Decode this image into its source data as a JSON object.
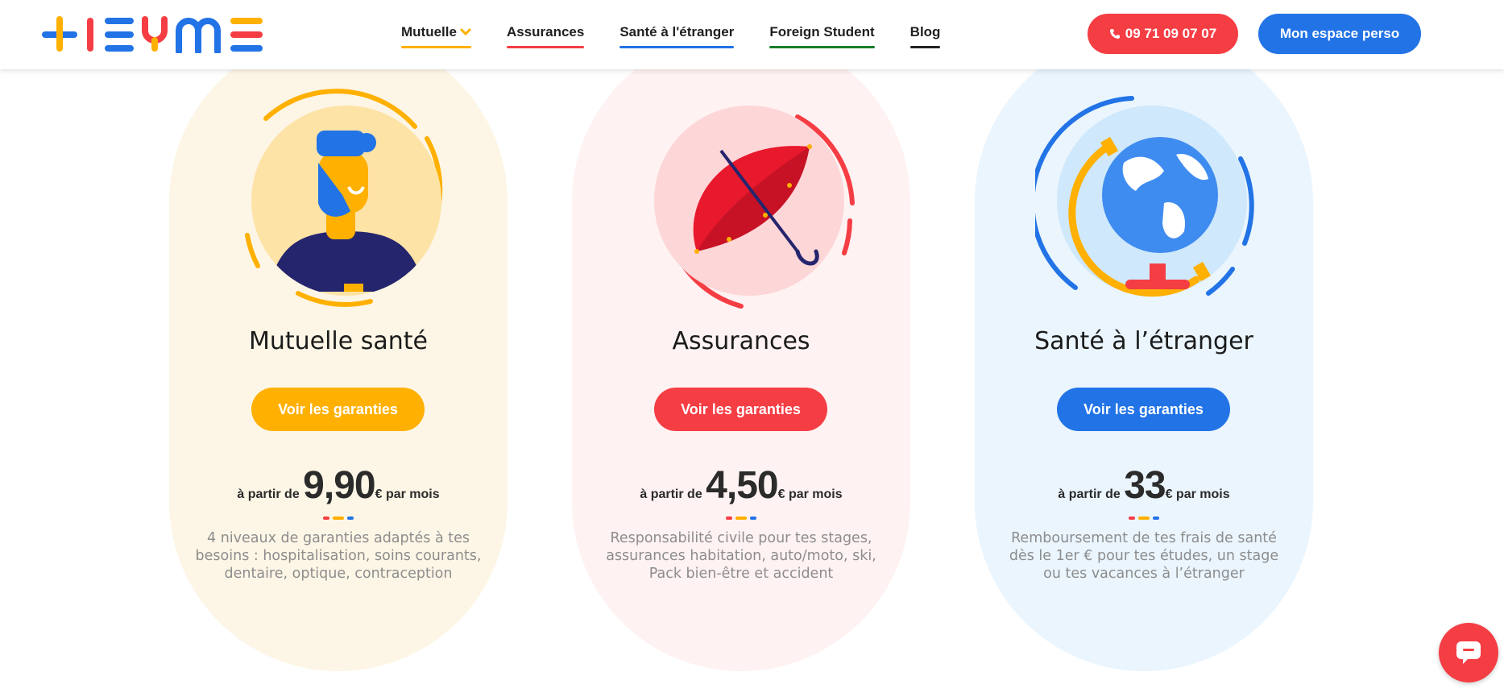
{
  "brand": {
    "logo_text": "HEYME",
    "colors": {
      "yellow": "#ffb000",
      "red": "#f53d44",
      "blue": "#2273e6",
      "green": "#1a7d2b",
      "dark": "#222222"
    }
  },
  "nav": {
    "items": [
      {
        "label": "Mutuelle",
        "underline": "#ffb000",
        "has_dropdown": true
      },
      {
        "label": "Assurances",
        "underline": "#f53d44"
      },
      {
        "label": "Santé à l'étranger",
        "underline": "#2273e6"
      },
      {
        "label": "Foreign Student",
        "underline": "#1a7d2b"
      },
      {
        "label": "Blog",
        "underline": "#222222"
      }
    ],
    "phone_label": "09 71 09 07 07",
    "account_label": "Mon espace perso"
  },
  "cards": [
    {
      "title": "Mutuelle santé",
      "cta": "Voir les garanties",
      "price_prefix": "à partir de",
      "price": "9,90",
      "price_suffix": "€ par mois",
      "description": "4 niveaux de garanties adaptés à tes besoins : hospitalisation, soins courants, dentaire, optique, contraception",
      "bg": "#fdf6e6",
      "accent": "#ffb000",
      "icon": "bearded-man-icon"
    },
    {
      "title": "Assurances",
      "cta": "Voir les garanties",
      "price_prefix": "à partir de",
      "price": "4,50",
      "price_suffix": "€ par mois",
      "description": "Responsabilité civile pour tes stages, assurances habitation, auto/moto, ski, Pack bien-être et accident",
      "bg": "#fff2f2",
      "accent": "#f53d44",
      "icon": "umbrella-icon"
    },
    {
      "title": "Santé à l’étranger",
      "cta": "Voir les garanties",
      "price_prefix": "à partir de",
      "price": "33",
      "price_suffix": "€ par mois",
      "description": "Remboursement de tes frais de santé dès le 1er € pour tes études, un stage ou tes vacances à l’étranger",
      "bg": "#eaf5fe",
      "accent": "#2273e6",
      "icon": "globe-icon"
    }
  ],
  "chat": {
    "icon": "chat-bubble-icon"
  }
}
